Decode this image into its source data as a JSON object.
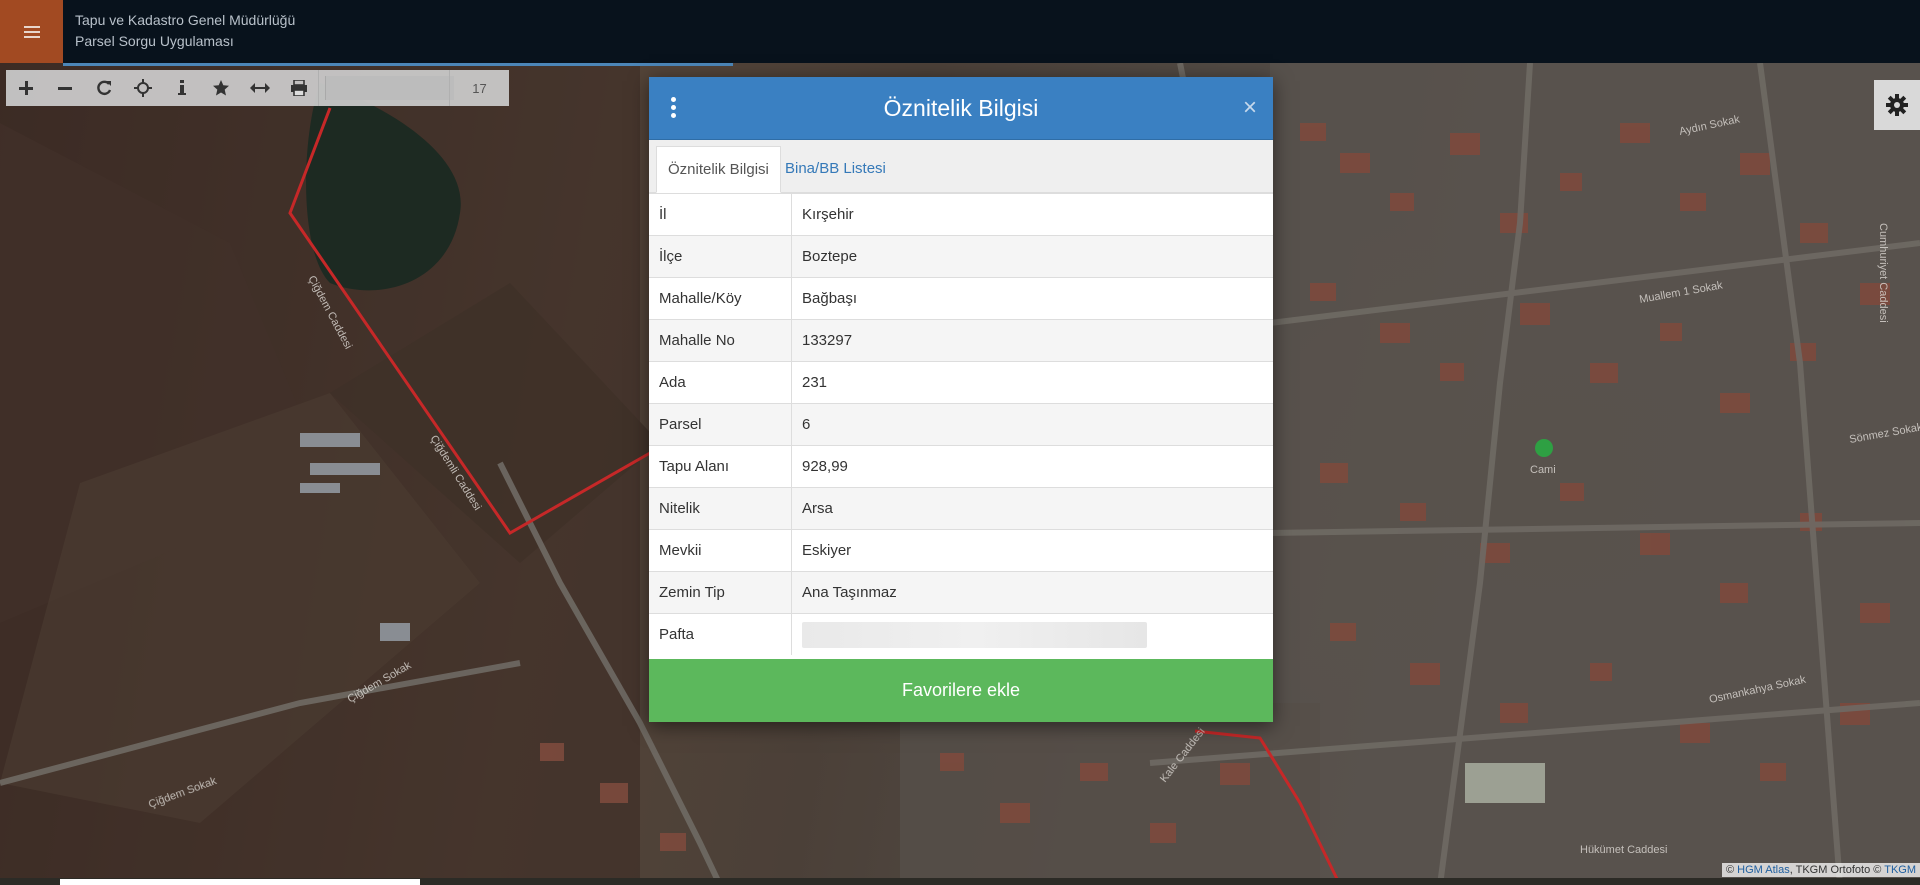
{
  "header": {
    "org_name": "Tapu ve Kadastro Genel Müdürlüğü",
    "app_name": "Parsel Sorgu Uygulaması",
    "menu_icon": "hamburger-icon"
  },
  "toolbar": {
    "tools": [
      {
        "name": "zoom-in",
        "icon": "plus-icon"
      },
      {
        "name": "zoom-out",
        "icon": "minus-icon"
      },
      {
        "name": "refresh",
        "icon": "refresh-icon"
      },
      {
        "name": "locate",
        "icon": "crosshair-icon"
      },
      {
        "name": "info",
        "icon": "info-icon"
      },
      {
        "name": "favorites",
        "icon": "star-icon"
      },
      {
        "name": "measure",
        "icon": "arrows-horizontal-icon"
      },
      {
        "name": "print",
        "icon": "print-icon"
      }
    ],
    "zoom_level": "17"
  },
  "settings_icon": "gear-icon",
  "dialog": {
    "title": "Öznitelik Bilgisi",
    "tabs": [
      {
        "label": "Öznitelik Bilgisi",
        "active": true
      },
      {
        "label": "Bina/BB Listesi",
        "active": false
      }
    ],
    "rows": [
      {
        "key": "İl",
        "value": "Kırşehir"
      },
      {
        "key": "İlçe",
        "value": "Boztepe"
      },
      {
        "key": "Mahalle/Köy",
        "value": "Bağbaşı"
      },
      {
        "key": "Mahalle No",
        "value": "133297"
      },
      {
        "key": "Ada",
        "value": "231"
      },
      {
        "key": "Parsel",
        "value": "6"
      },
      {
        "key": "Tapu Alanı",
        "value": "928,99"
      },
      {
        "key": "Nitelik",
        "value": "Arsa"
      },
      {
        "key": "Mevkii",
        "value": "Eskiyer"
      },
      {
        "key": "Zemin Tip",
        "value": "Ana Taşınmaz"
      },
      {
        "key": "Pafta",
        "value": ""
      }
    ],
    "favorite_button": "Favorilere ekle",
    "close_symbol": "×"
  },
  "map": {
    "labels": [
      "Çiğdem Sokak",
      "Çiğdem Caddesi",
      "Çiğdemli Caddesi",
      "Cami",
      "Kale Caddesi",
      "Hükümet Caddesi",
      "Osmankahya Sokak",
      "Cumhuriyet Caddesi",
      "Muallem 1 Sokak",
      "Sönmez Sokak",
      "Aydın Sokak"
    ],
    "attribution_prefix": "© ",
    "attribution_link1": "HGM Atlas",
    "attribution_mid": ", TKGM Ortofoto © ",
    "attribution_link2": "TKGM",
    "parcel_line_color": "#c62828",
    "mosque_marker_color": "#2ea043"
  }
}
